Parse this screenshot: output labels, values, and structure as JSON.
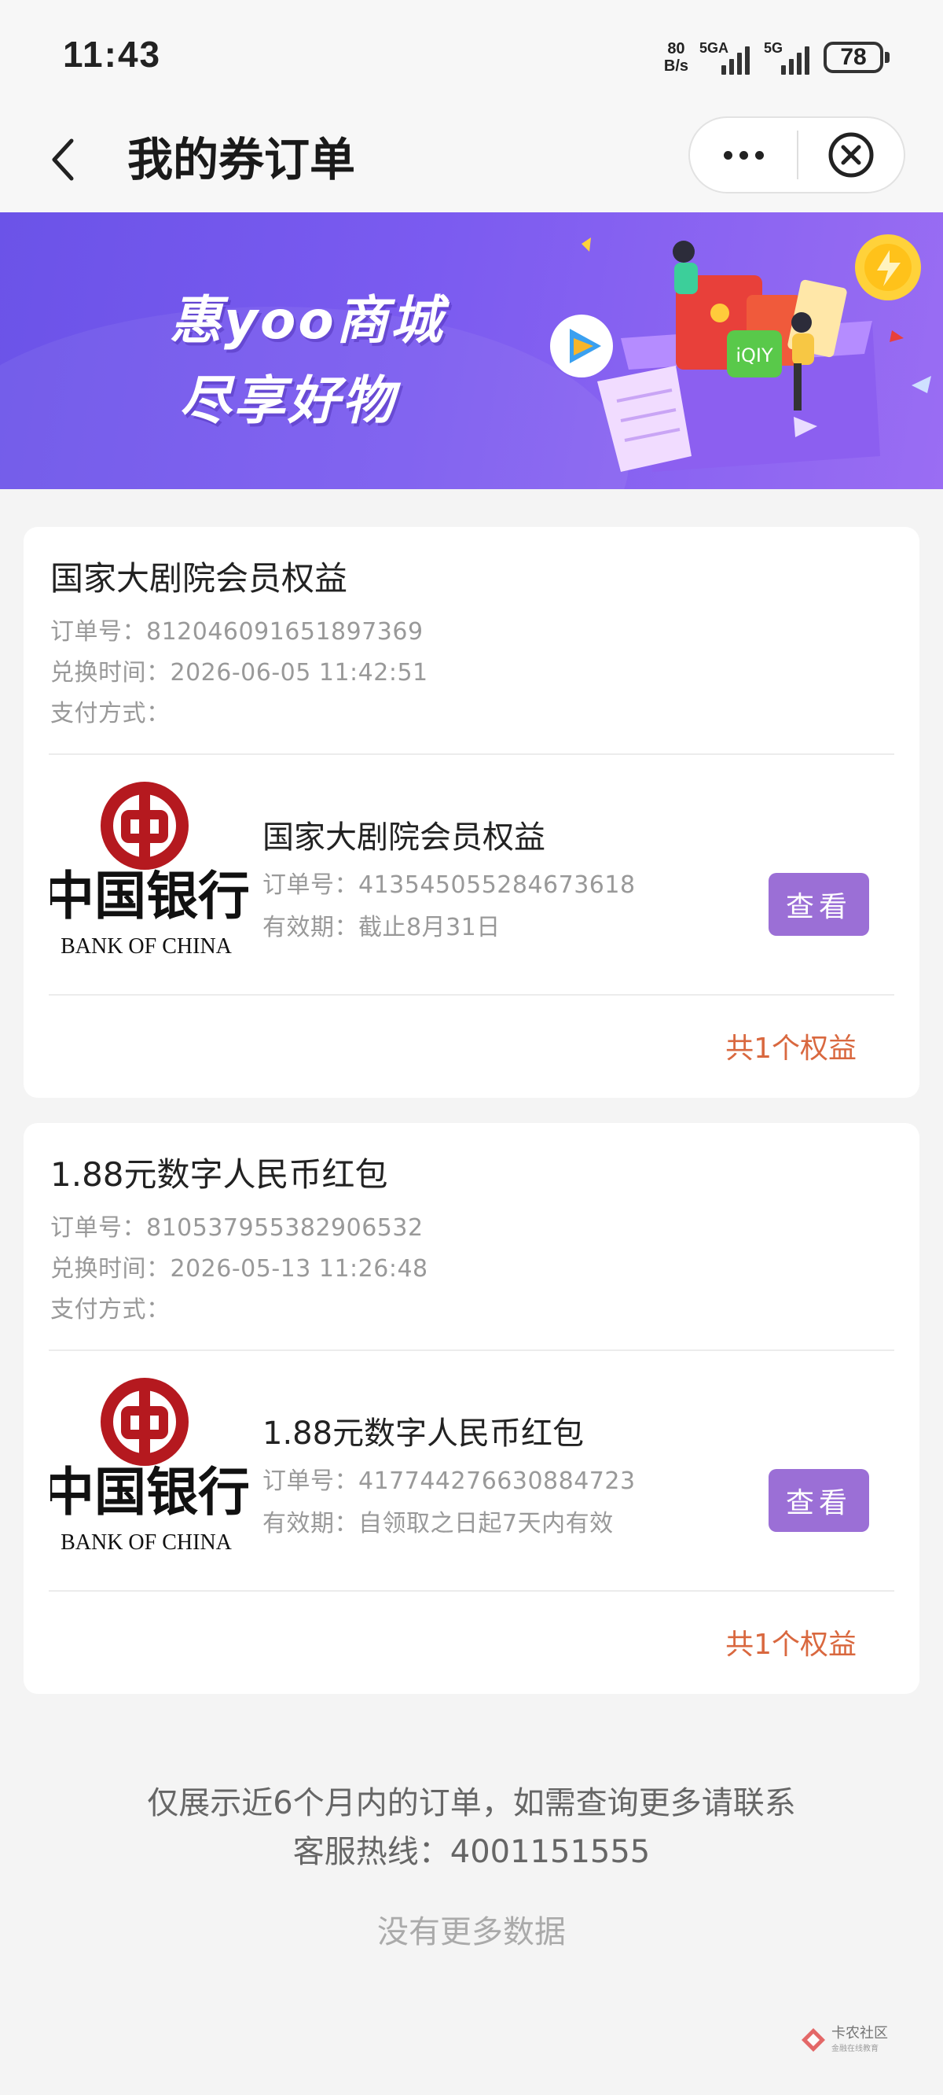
{
  "status_bar": {
    "time": "11:43",
    "net_speed_value": "80",
    "net_speed_unit": "B/s",
    "sim1_label": "5GA",
    "sim2_label": "5G",
    "battery": "78"
  },
  "nav": {
    "title": "我的券订单"
  },
  "banner": {
    "line1": "惠yoo商城",
    "line2": "尽享好物"
  },
  "orders": [
    {
      "title": "国家大剧院会员权益",
      "order_no": "订单号：812046091651897369",
      "exchange_time": "兑换时间：2026-06-05 11:42:51",
      "pay_method": "支付方式：",
      "item": {
        "bank_name_cn": "中国银行",
        "bank_name_en": "BANK OF CHINA",
        "title": "国家大剧院会员权益",
        "order_no": "订单号：413545055284673618",
        "validity": "有效期：截止8月31日",
        "button": "查看"
      },
      "count": "共1个权益"
    },
    {
      "title": "1.88元数字人民币红包",
      "order_no": "订单号：810537955382906532",
      "exchange_time": "兑换时间：2026-05-13 11:26:48",
      "pay_method": "支付方式：",
      "item": {
        "bank_name_cn": "中国银行",
        "bank_name_en": "BANK OF CHINA",
        "title": "1.88元数字人民币红包",
        "order_no": "订单号：417744276630884723",
        "validity": "有效期：自领取之日起7天内有效",
        "button": "查看"
      },
      "count": "共1个权益"
    }
  ],
  "footer": {
    "notice_line1": "仅展示近6个月内的订单，如需查询更多请联系",
    "notice_line2": "客服热线：4001151555",
    "no_more": "没有更多数据",
    "watermark": "卡农社区",
    "watermark_sub": "金融在线教育"
  },
  "colors": {
    "view_button": "#9b6fd6",
    "benefit_count": "#d9683f",
    "banner_start": "#6b53e8",
    "banner_end": "#9a6df3",
    "boc_red": "#b5191f"
  }
}
